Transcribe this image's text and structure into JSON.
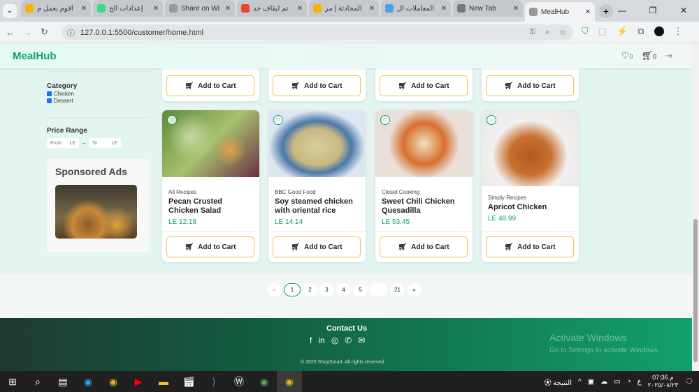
{
  "browser": {
    "tabs": [
      {
        "title": "اقوم بعمل م",
        "color": "#f4b400"
      },
      {
        "title": "إعدادات الح",
        "color": "#3ddc84"
      },
      {
        "title": "Share on Wi",
        "color": "#999"
      },
      {
        "title": "تم ايقاف خد",
        "color": "#ea4335"
      },
      {
        "title": "المحادثة | مر",
        "color": "#f4b400"
      },
      {
        "title": "المعاملات ال",
        "color": "#4aa3df"
      },
      {
        "title": "New Tab",
        "color": "#777"
      },
      {
        "title": "MealHub",
        "color": "#999"
      }
    ],
    "url": "127.0.0.1:5500/customer/home.html"
  },
  "nav": {
    "logo": "MealHub",
    "wishlist_count": "0",
    "cart_count": "0"
  },
  "filters": {
    "category_title": "Category",
    "categories": [
      "Chicken",
      "Dessert"
    ],
    "price_title": "Price Range",
    "from_placeholder": "From",
    "to_placeholder": "To",
    "currency": "LE",
    "dash": "–"
  },
  "ads": {
    "title": "Sponsored Ads"
  },
  "add_to_cart": "Add to Cart",
  "products": [
    {
      "source": "All Recipes",
      "name": "Pecan Crusted Chicken Salad",
      "price": "LE 12.18"
    },
    {
      "source": "BBC Good Food",
      "name": "Soy steamed chicken with oriental rice",
      "price": "LE 14.14"
    },
    {
      "source": "Closet Cooking",
      "name": "Sweet Chili Chicken Quesadilla",
      "price": "LE 53.45"
    },
    {
      "source": "Simply Recipes",
      "name": "Apricot Chicken",
      "price": "LE 48.99"
    }
  ],
  "pagination": [
    "«",
    "1",
    "2",
    "3",
    "4",
    "5",
    "..",
    "21",
    "»"
  ],
  "current_page": "1",
  "footer": {
    "contact": "Contact Us",
    "copyright": "© 2025 ShopSmart. All rights reserved.",
    "activate_title": "Activate Windows",
    "activate_sub": "Go to Settings to activate Windows."
  },
  "taskbar": {
    "weather": "النتيجة",
    "time": "07:36 م",
    "date": "٢٠٢٥/٠٨/٢٣",
    "lang": "ع"
  }
}
